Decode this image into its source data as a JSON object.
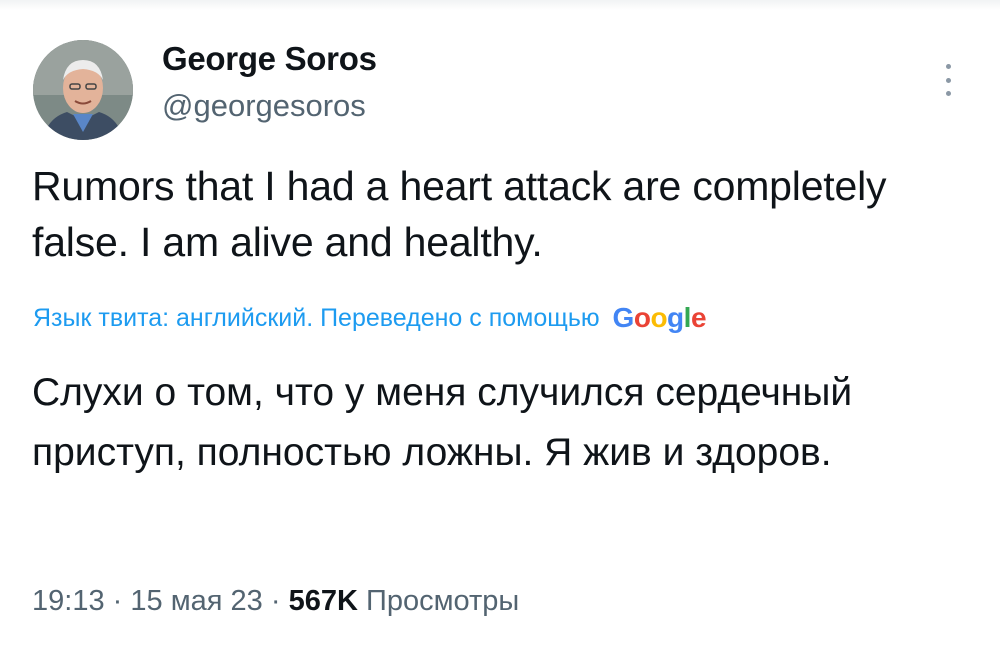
{
  "author": {
    "name": "George Soros",
    "handle": "@georgesoros"
  },
  "tweet": {
    "text": "Rumors that I had a heart attack are completely false. I am alive and healthy.",
    "translation_note": "Язык твита: английский. Переведено с помощью",
    "translation_provider": "Google",
    "translated_text": "Слухи о том, что у меня случился сердечный приступ, полностью ложны. Я жив и здоров."
  },
  "meta": {
    "time": "19:13",
    "separator": "·",
    "date": "15 мая 23",
    "views_count": "567K",
    "views_label": "Просмотры"
  },
  "icons": {
    "more": "more-vertical-icon",
    "avatar": "avatar"
  },
  "colors": {
    "link": "#1d9bf0",
    "secondary_text": "#536471",
    "primary_text": "#0f1419",
    "google_blue": "#4285f4",
    "google_red": "#ea4335",
    "google_yellow": "#fbbc05",
    "google_green": "#34a853"
  }
}
